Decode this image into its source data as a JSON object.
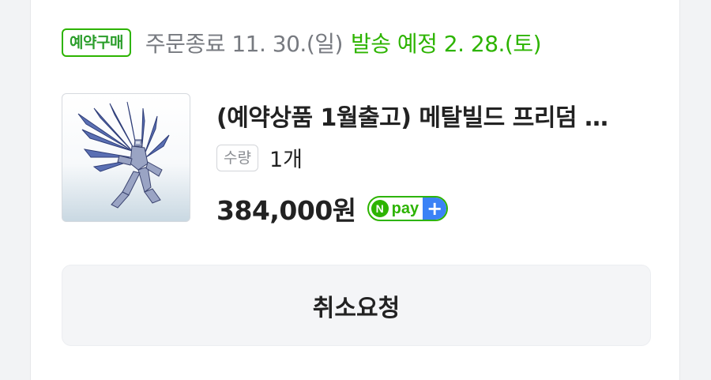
{
  "order": {
    "badge": "예약구매",
    "deadline": "주문종료 11. 30.(일)",
    "shipping": "발송 예정 2. 28.(토)",
    "product_title": "(예약상품 1월출고) 메탈빌드 프리덤 …",
    "quantity_label": "수량",
    "quantity_value": "1개",
    "price": "384,000원",
    "npay_text": "pay",
    "npay_n": "N",
    "npay_plus": "+",
    "cancel_label": "취소요청"
  },
  "colors": {
    "accent_green": "#2db400",
    "npay_blue": "#3b82f6",
    "muted_text": "#777a80"
  },
  "icons": {
    "product_image": "robot-figure-thumbnail",
    "npay_logo": "npay-plus-logo"
  }
}
